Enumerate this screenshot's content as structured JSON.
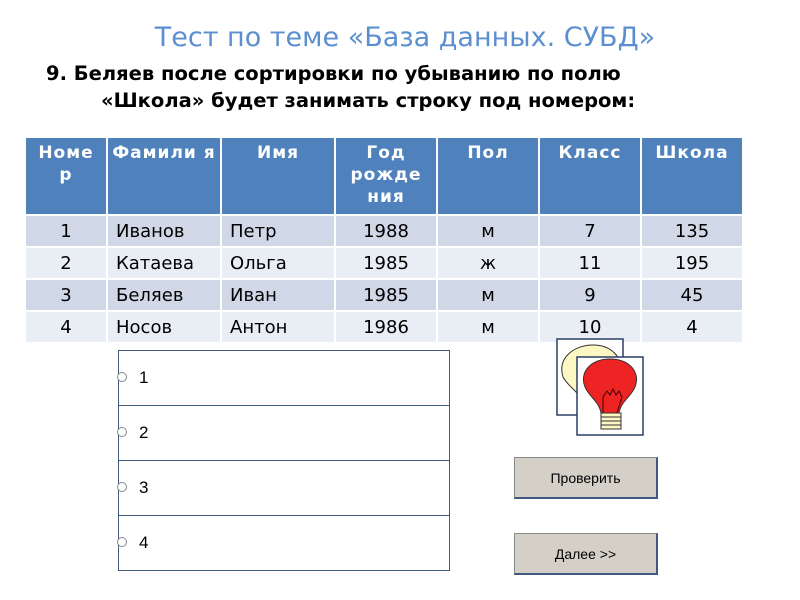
{
  "title": "Тест по теме «База данных. СУБД»",
  "question": {
    "line1": "9. Беляев после сортировки по убыванию по полю",
    "line2": "«Школа» будет занимать строку под номером:"
  },
  "table": {
    "headers": [
      "Номе р",
      "Фамили я",
      "Имя",
      "Год рожде ния",
      "Пол",
      "Класс",
      "Школа"
    ],
    "rows": [
      [
        "1",
        "Иванов",
        "Петр",
        "1988",
        "м",
        "7",
        "135"
      ],
      [
        "2",
        "Катаева",
        "Ольга",
        "1985",
        "ж",
        "11",
        "195"
      ],
      [
        "3",
        "Беляев",
        "Иван",
        "1985",
        "м",
        "9",
        "45"
      ],
      [
        "4",
        "Носов",
        "Антон",
        "1986",
        "м",
        "10",
        "4"
      ]
    ]
  },
  "answers": [
    "1",
    "2",
    "3",
    "4"
  ],
  "buttons": {
    "check": "Проверить",
    "next": "Далее >>"
  },
  "icons": {
    "hint": "lightbulb-icon"
  },
  "colors": {
    "title": "#5b8fd0",
    "header_bg": "#4f81bd",
    "row_odd": "#d0d8e8",
    "row_even": "#e9edf4",
    "button_bg": "#d4d0c8"
  }
}
